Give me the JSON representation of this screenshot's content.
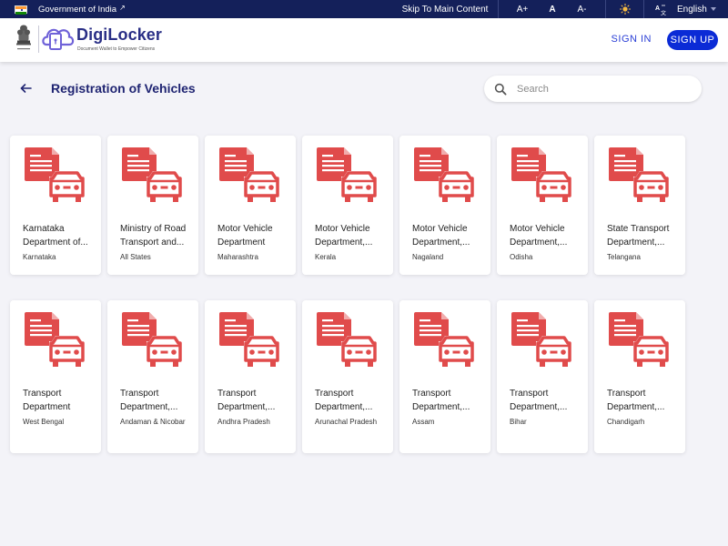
{
  "gov_bar": {
    "text": "Government of India",
    "skip": "Skip To Main Content",
    "font_increase": "A+",
    "font_normal": "A",
    "font_decrease": "A-",
    "language": "English"
  },
  "header": {
    "logo_name": "DigiLocker",
    "logo_tagline": "Document Wallet to Empower Citizens",
    "sign_in": "SIGN IN",
    "sign_up": "SIGN UP"
  },
  "page": {
    "title": "Registration of Vehicles",
    "search_placeholder": "Search"
  },
  "colors": {
    "gov_bar": "#14205a",
    "accent": "#0b2bd6",
    "title": "#1f2472",
    "card_icon": "#e04b4b"
  },
  "cards": [
    {
      "title": "Karnataka Department of...",
      "subtitle": "Karnataka"
    },
    {
      "title": "Ministry of Road Transport and...",
      "subtitle": "All States"
    },
    {
      "title": "Motor Vehicle Department",
      "subtitle": "Maharashtra"
    },
    {
      "title": "Motor Vehicle Department,...",
      "subtitle": "Kerala"
    },
    {
      "title": "Motor Vehicle Department,...",
      "subtitle": "Nagaland"
    },
    {
      "title": "Motor Vehicle Department,...",
      "subtitle": "Odisha"
    },
    {
      "title": "State Transport Department,...",
      "subtitle": "Telangana"
    },
    {
      "title": "Transport Department",
      "subtitle": "West Bengal"
    },
    {
      "title": "Transport Department,...",
      "subtitle": "Andaman & Nicobar"
    },
    {
      "title": "Transport Department,...",
      "subtitle": "Andhra Pradesh"
    },
    {
      "title": "Transport Department,...",
      "subtitle": "Arunachal Pradesh"
    },
    {
      "title": "Transport Department,...",
      "subtitle": "Assam"
    },
    {
      "title": "Transport Department,...",
      "subtitle": "Bihar"
    },
    {
      "title": "Transport Department,...",
      "subtitle": "Chandigarh"
    }
  ]
}
